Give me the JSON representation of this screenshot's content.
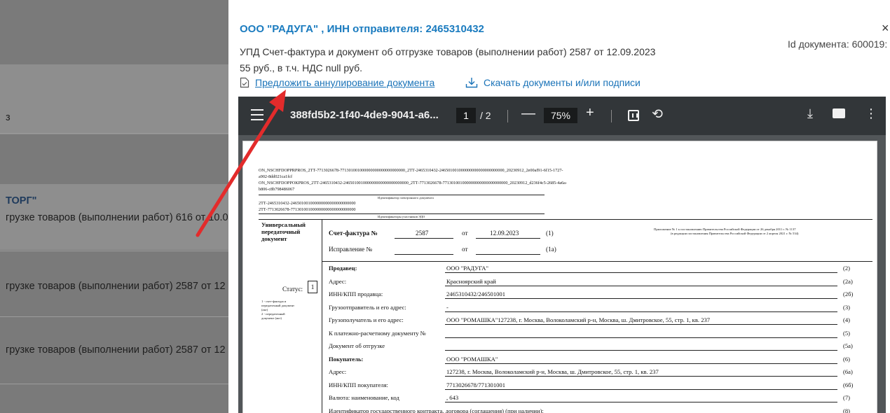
{
  "background_list": {
    "letter": "з",
    "company": "ТОРГ\"",
    "row1": "грузке товаров (выполнении работ) 616 от 10.0",
    "row2": "грузке товаров (выполнении работ) 2587 от 12",
    "row3": "грузке товаров (выполнении работ) 2587 от 12"
  },
  "modal": {
    "title": "ООО \"РАДУГА\" , ИНН отправителя: 2465310432",
    "close": "×",
    "doc_id": "Id документа: 600019:",
    "subtitle": "УПД Счет-фактура и документ об отгрузке товаров (выполнении работ) 2587 от 12.09.2023",
    "sum": "55 руб., в т.ч. НДС null руб.",
    "cancel_link": "Предложить аннулирование документа",
    "download_link": "Скачать документы и/или подписи"
  },
  "viewer": {
    "file_name": "388fd5b2-1f40-4de9-9041-a6...",
    "page_current": "1",
    "page_total": "/ 2",
    "minus": "—",
    "zoom": "75%",
    "plus": "+",
    "rotate_glyph": "⟲",
    "download_glyph": "⤓",
    "more_glyph": "⋮"
  },
  "pdf": {
    "file_line1": "ON_NSCHFDOPPRPROS_2ТТ-7713026678-771301001000000000000000000000_2ТТ-2465310432-246501001000000000000000000000_20230912_2e00af91-6f15-1727-",
    "file_line2": "a902-8dd021ca1fcf",
    "file_line3": "ON_NSCHFDOPPOKPROS_2ТТ-2465310432-246501001000000000000000000000_2ТТ-7713026678-771301001000000000000000000000_20230912_d236f4c5-2685-4a6a-",
    "file_line4": "b806-c8b798486067",
    "file_caption": "Идентификатор электронного документа",
    "participant1": "2ТТ-2465310432-246501001000000000000000000000",
    "participant2": "2ТТ-7713026678-771301001000000000000000000000",
    "participant_caption": "Идентификаторы участников ЭДО",
    "upd_label": "Универсальный передаточный документ",
    "invoice_label": "Счет-фактура №",
    "invoice_no": "2587",
    "ot1": "от",
    "invoice_date": "12.09.2023",
    "code1": "(1)",
    "correction_label": "Исправление №",
    "ot2": "от",
    "code1a": "(1а)",
    "appendix1": "Приложение № 1 к постановлению Правительства Российской Федерации от 26 декабря 2011 г. № 1137",
    "appendix2": "(в редакции постановления Правительства Российской Федерации от 2 апреля 2021 г. № 534)",
    "status_label": "Статус:",
    "status_value": "1",
    "status_note1": "1 - счет-фактура и",
    "status_note2": "передаточный документ",
    "status_note3": "(акт)",
    "status_note4": "2 - передаточный",
    "status_note5": "документ (акт)",
    "rows": [
      {
        "label": "Продавец:",
        "value": "ООО \"РАДУГА\"",
        "code": "(2)",
        "bold": true
      },
      {
        "label": "Адрес:",
        "value": "Красноярский край",
        "code": "(2а)",
        "bold": false
      },
      {
        "label": "ИНН/КПП продавца:",
        "value": "2465310432/246501001",
        "code": "(2б)",
        "bold": false
      },
      {
        "label": "Грузоотправитель и его адрес:",
        "value": "-",
        "code": "(3)",
        "bold": false
      },
      {
        "label": "Грузополучатель и его адрес:",
        "value": "ООО \"РОМАШКА\"127238, г. Москва, Волоколамский р-н, Москва, ш. Дмитровское, 55, стр. 1, кв. 237",
        "code": "(4)",
        "bold": false
      },
      {
        "label": "К платежно-расчетному документу №",
        "value": "",
        "code": "(5)",
        "bold": false
      },
      {
        "label": "Документ об отгрузке",
        "value": "",
        "code": "(5а)",
        "bold": false
      },
      {
        "label": "Покупатель:",
        "value": "ООО \"РОМАШКА\"",
        "code": "(6)",
        "bold": true
      },
      {
        "label": "Адрес:",
        "value": "127238, г. Москва, Волоколамский р-н, Москва, ш. Дмитровское, 55, стр. 1, кв. 237",
        "code": "(6а)",
        "bold": false
      },
      {
        "label": "ИНН/КПП покупателя:",
        "value": "7713026678/771301001",
        "code": "(6б)",
        "bold": false
      },
      {
        "label": "Валюта: наименование, код",
        "value": ", 643",
        "code": "(7)",
        "bold": false
      },
      {
        "label": "Идентификатор государственного контракта, договора (соглашения) (при наличии):",
        "value": "",
        "code": "(8)",
        "bold": false
      }
    ]
  },
  "colors": {
    "title_blue": "#1a7bbf",
    "link_blue": "#1a73b8",
    "arrow_red": "#e32b2b",
    "toolbar": "#323639",
    "viewer_bg": "#525659"
  }
}
